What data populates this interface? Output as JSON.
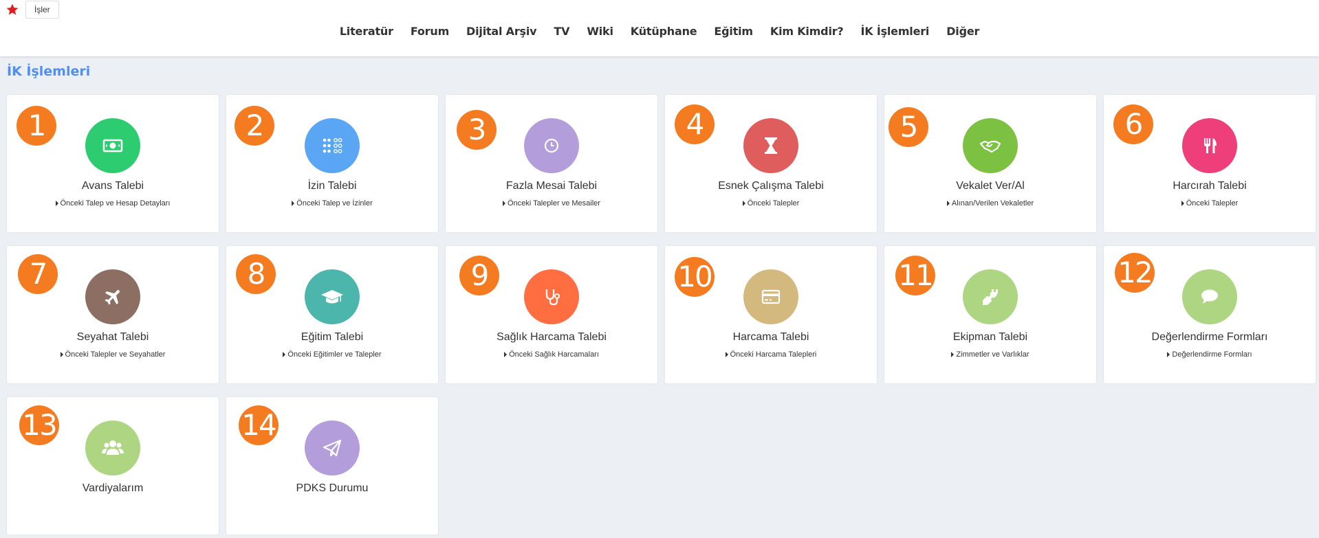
{
  "topbar": {
    "tab_label": "İşler"
  },
  "nav": [
    "Literatür",
    "Forum",
    "Dijital Arşiv",
    "TV",
    "Wiki",
    "Kütüphane",
    "Eğitim",
    "Kim Kimdir?",
    "İK İşlemleri",
    "Diğer"
  ],
  "section_title": "İK İşlemleri",
  "colors": {
    "accent": "#4f8ff0",
    "badge": "#f47b20"
  },
  "cards": [
    {
      "number": "1",
      "title": "Avans Talebi",
      "subtitle": "Önceki Talep ve Hesap Detayları",
      "icon": "money-icon",
      "color": "#2ecc71"
    },
    {
      "number": "2",
      "title": "İzin Talebi",
      "subtitle": "Önceki Talep ve İzinler",
      "icon": "grid-dots-icon",
      "color": "#5aa6f5"
    },
    {
      "number": "3",
      "title": "Fazla Mesai Talebi",
      "subtitle": "Önceki Talepler ve Mesailer",
      "icon": "clock-icon",
      "color": "#b39ddb"
    },
    {
      "number": "4",
      "title": "Esnek Çalışma Talebi",
      "subtitle": "Önceki Talepler",
      "icon": "hourglass-icon",
      "color": "#e05d5d"
    },
    {
      "number": "5",
      "title": "Vekalet Ver/Al",
      "subtitle": "Alınan/Verilen Vekaletler",
      "icon": "handshake-icon",
      "color": "#7cc142"
    },
    {
      "number": "6",
      "title": "Harcırah Talebi",
      "subtitle": "Önceki Talepler",
      "icon": "cutlery-icon",
      "color": "#ee3f7a"
    },
    {
      "number": "7",
      "title": "Seyahat Talebi",
      "subtitle": "Önceki Talepler ve Seyahatler",
      "icon": "airplane-icon",
      "color": "#8d6e63"
    },
    {
      "number": "8",
      "title": "Eğitim Talebi",
      "subtitle": "Önceki Eğitimler ve Talepler",
      "icon": "graduation-cap-icon",
      "color": "#4db6ac"
    },
    {
      "number": "9",
      "title": "Sağlık Harcama Talebi",
      "subtitle": "Önceki Sağlık Harcamaları",
      "icon": "stethoscope-icon",
      "color": "#ff6e40"
    },
    {
      "number": "10",
      "title": "Harcama Talebi",
      "subtitle": "Önceki Harcama Talepleri",
      "icon": "credit-card-icon",
      "color": "#d4b97f"
    },
    {
      "number": "11",
      "title": "Ekipman Talebi",
      "subtitle": "Zimmetler ve Varlıklar",
      "icon": "plug-icon",
      "color": "#aed581"
    },
    {
      "number": "12",
      "title": "Değerlendirme Formları",
      "subtitle": "Değerlendirme Formları",
      "icon": "chat-bubble-icon",
      "color": "#aed581"
    },
    {
      "number": "13",
      "title": "Vardiyalarım",
      "subtitle": "",
      "icon": "users-icon",
      "color": "#aed581"
    },
    {
      "number": "14",
      "title": "PDKS Durumu",
      "subtitle": "",
      "icon": "paper-plane-icon",
      "color": "#b39ddb"
    }
  ]
}
